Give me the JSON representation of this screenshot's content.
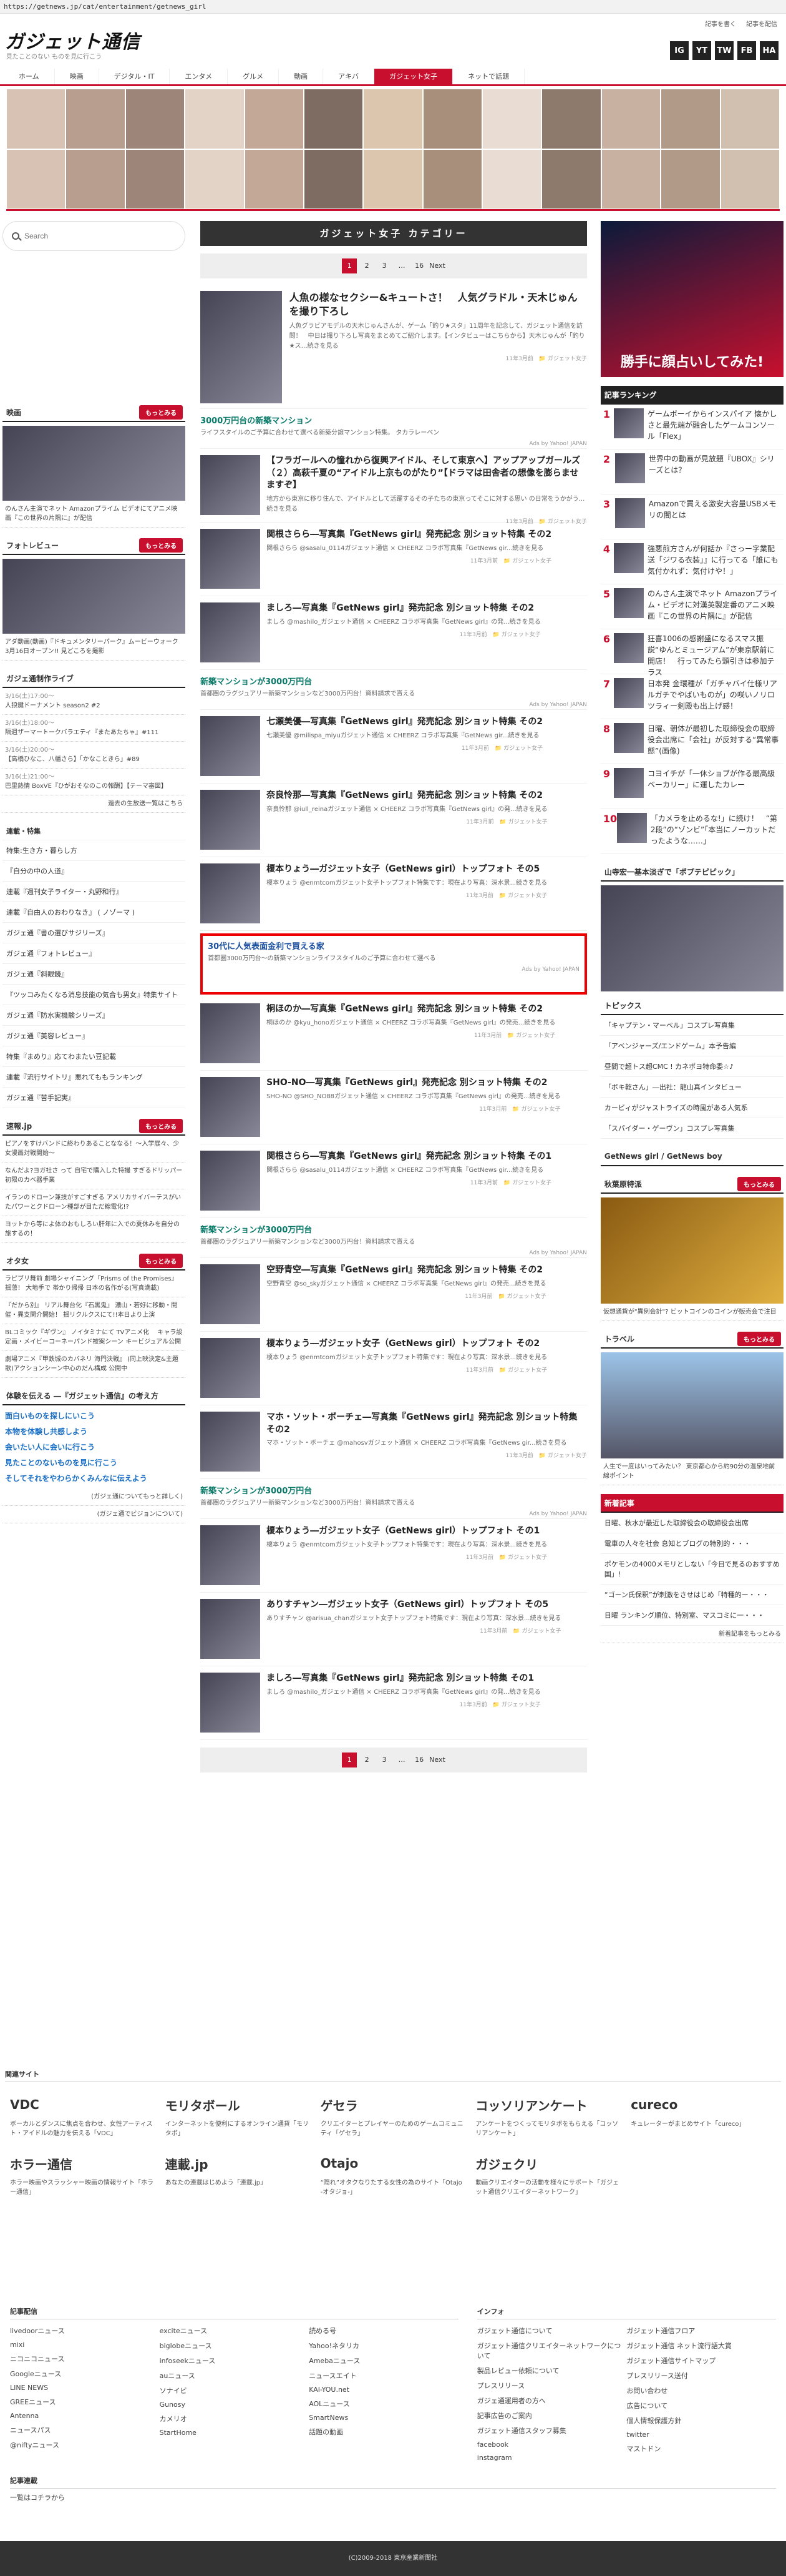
{
  "url": "https://getnews.jp/cat/entertainment/getnews_girl",
  "header": {
    "logo": "ガジェット通信",
    "tagline": "見たことのない ものを見に行こう",
    "links": [
      "記事を書く",
      "記事を配信"
    ],
    "social": [
      "IG",
      "YT",
      "TW",
      "FB",
      "HA"
    ]
  },
  "nav": [
    "ホーム",
    "映画",
    "デジタル・IT",
    "エンタメ",
    "グルメ",
    "動画",
    "アキバ",
    "ガジェット女子",
    "ネットで話題"
  ],
  "search": {
    "placeholder": "Search"
  },
  "left": {
    "movie": {
      "title": "映画",
      "more": "もっとみる",
      "caption": "のんさん主演でネット Amazonプライム ビデオにてアニメ映画『この世界の片隅に』が配信"
    },
    "photo": {
      "title": "フォトレビュー",
      "more": "もっとみる",
      "caption": "アダ動画(動画)『ドキュメンタリーパーク』ムービーウォーク 3月16日オープン!! 見どころを撮影"
    },
    "live": {
      "title": "ガジェ通制作ライブ",
      "items": [
        {
          "d": "3/16(土)17:00〜",
          "t": "人狼鍵ドーナメント season2 #2"
        },
        {
          "d": "3/16(土)18:00〜",
          "t": "隔週ザーマートークバラエティ『またあたちゃ』#111"
        },
        {
          "d": "3/16(土)20:00〜",
          "t": "【高橋ひなこ、八幡さら】「かなこときら」#89"
        },
        {
          "d": "3/16(土)21:00〜",
          "t": "巴里熱情 BoxVE『ひがおそなのこの報酬】【テーマ審図】"
        }
      ],
      "more": "過去の生放送一覧はこちら"
    },
    "tokushu": {
      "title": "連載・特集",
      "items": [
        "特集:生き方・暮らし方",
        "『自分の中の人道』",
        "連載『週刊女子ライター・丸野和行』",
        "連載『自由人のおわりなき』 ( ノゾーマ )",
        "ガジェ通『書の選びサジリーズ』",
        "ガジェ通『フォトレビュー』",
        "ガジェ通『斜眼鏡』",
        "『ツッコみたくなる消息技能の気合も男女』特集サイト",
        "ガジェ通『防水実機験シリーズ』",
        "ガジェ通『美容レビュー』",
        "特集『まめり』応てわまたい豆記載",
        "連載『流行サイトリ』悪れてももランキング",
        "ガジェ通『苦手記実』"
      ]
    },
    "rensai": {
      "title": "速報.jp",
      "more": "もっとみる",
      "items": [
        "ピアノをすけバンドに終わりあることななる！〜入学展々、少女漫画対戦開始〜",
        "なんだよ?ヨガ社さ って 自宅で購入した特撮 すぎるドリッパー初限のカベ器手業",
        "イランのドローン兼技がすごすぎる アメリカサイバーテスがいたパワーとクドローン種部が目ただ線電化!?",
        "ヨットから等によ体のおもしろい肝年に入での夏休みを自分の旅するの！"
      ]
    },
    "otaku": {
      "title": "オタ女",
      "more": "もっとみる",
      "items": [
        "ラピブリ舞前 劇場シャイニング『Prisms of the Promises』 揺蕩！ 大地手で 帯かり帰帰 日本の名作がる(写真満載)",
        "『だから別』 リアル舞台化『石黒鬼』 濃山・若好に移動・開催・異支関介開始！ 揺リクルクスにて!!本日より上演",
        "BLコミック『ギヴン』 ノイタミナにて TVアニメ化 　キャラ設定画・メイビーコーネーパンド被案シーン キービジュアル公開",
        "劇場アニメ『甲鉄城のカバネリ 海門決戦』 (同上映決定&主題歌)アクションシーン中心のだん構成 公開中"
      ]
    },
    "shumi": {
      "title": "体験を伝える ―『ガジェット通信』の考え方",
      "items": [
        "面白いものを探しにいこう",
        "本物を体験し共感しよう",
        "会いたい人に会いに行こう",
        "見たことのないものを見に行こう",
        "そしてそれをやわらかくみんなに伝えよう",
        "(ガジェ通についてもっと詳しく)",
        "(ガジェ通でビジョンについて)"
      ]
    }
  },
  "center": {
    "title": "ガジェット女子 カテゴリー",
    "pager": [
      "1",
      "2",
      "3",
      "…",
      "16",
      "Next"
    ],
    "feature": {
      "t": "人魚の様なセクシー&キュートさ！　人気グラドル・天木じゅんを撮り下ろし",
      "d": "人魚グラビアモデルの天木じゅんさんが、ゲーム「釣り★スタ」11周年を記念して、ガジェット通信を訪問！　中日は撮り下ろし写真をまとめてご紹介します。【インタビューはこちらから】天木じゅんが「釣り★ス…続きを見る",
      "m": "11年3月前　📁 ガジェット女子"
    },
    "list": [
      {
        "type": "ad",
        "t": "3000万円台の新築マンション",
        "d": "ライフスタイルのご予算に合わせて選べる新築分譲マンション特集。 タカラレーベン",
        "m": "Ads by Yahoo! JAPAN"
      },
      {
        "type": "item",
        "t": "【フラガールへの憧れから復興アイドル、そして東京へ】アップアップガールズ（２）高萩千夏の“アイドル上京ものがたり”【ドラマは田舎者の想像を膨らませますぞ】",
        "d": "地方から東京に移り住んで、アイドルとして活躍するその子たちの東京ってそこに対する思い の日常をうかがう...続きを見る",
        "m": "11年3月前　📁 ガジェット女子"
      },
      {
        "type": "item",
        "t": "関根さらら―写真集『GetNews girl』発売記念 別ショット特集 その2",
        "d": "関根さらら @sasalu_0114ガジェット通信 × CHEERZ コラボ写真集『GetNews gir...続きを見る",
        "m": "11年3月前　📁 ガジェット女子"
      },
      {
        "type": "item",
        "t": "ましろ―写真集『GetNews girl』発売記念 別ショット特集 その2",
        "d": "ましろ @mashilo_ガジェット通信 × CHEERZ コラボ写真集『GetNews girl』の発...続きを見る",
        "m": "11年3月前　📁 ガジェット女子"
      },
      {
        "type": "ad",
        "t": "新築マンションが3000万円台",
        "d": "首都圏のラグジュアリー新築マンションなど3000万円台！資料請求で貰える",
        "m": "Ads by Yahoo! JAPAN"
      },
      {
        "type": "item",
        "t": "七瀬美優―写真集『GetNews girl』発売記念 別ショット特集 その2",
        "d": "七瀬美優 @milispa_miyuガジェット通信 × CHEERZ コラボ写真集『GetNews gir...続きを見る",
        "m": "11年3月前　📁 ガジェット女子"
      },
      {
        "type": "item",
        "t": "奈良怜那―写真集『GetNews girl』発売記念 別ショット特集 その2",
        "d": "奈良怜那 @iull_reinaガジェット通信 × CHEERZ コラボ写真集『GetNews girl』の発...続きを見る",
        "m": "11年3月前　📁 ガジェット女子"
      },
      {
        "type": "item",
        "t": "榎本りょう―ガジェット女子（GetNews girl）トップフォト その5",
        "d": "榎本りょう @enmtcomガジェット女子トップフォト特集です：現在より写真：深水景...続きを見る",
        "m": "11年3月前　📁 ガジェット女子"
      },
      {
        "type": "hl",
        "t": "30代に人気表面金利で買える家",
        "d": "首都圏3000万円台〜の新築マンションライフスタイルのご予算に合わせて選べる",
        "m": "Ads by Yahoo! JAPAN"
      },
      {
        "type": "item",
        "t": "桐ほのか―写真集『GetNews girl』発売記念 別ショット特集 その2",
        "d": "桐ほのか @kyu_honoガジェット通信 × CHEERZ コラボ写真集『GetNews girl』の発売...続きを見る",
        "m": "11年3月前　📁 ガジェット女子"
      },
      {
        "type": "item",
        "t": "SHO-NO―写真集『GetNews girl』発売記念 別ショット特集 その2",
        "d": "SHO-NO @SHO_NO88ガジェット通信 × CHEERZ コラボ写真集『GetNews girl』の発売...続きを見る",
        "m": "11年3月前　📁 ガジェット女子"
      },
      {
        "type": "item",
        "t": "関根さらら―写真集『GetNews girl』発売記念 別ショット特集 その1",
        "d": "関根さらら @sasalu_0114ガジェット通信 × CHEERZ コラボ写真集『GetNews gir...続きを見る",
        "m": "11年3月前　📁 ガジェット女子"
      },
      {
        "type": "ad",
        "t": "新築マンションが3000万円台",
        "d": "首都圏のラグジュアリー新築マンションなど3000万円台！資料請求で貰える",
        "m": "Ads by Yahoo! JAPAN"
      },
      {
        "type": "item",
        "t": "空野青空―写真集『GetNews girl』発売記念 別ショット特集 その2",
        "d": "空野青空 @so_skyガジェット通信 × CHEERZ コラボ写真集『GetNews girl』の発売...続きを見る",
        "m": "11年3月前　📁 ガジェット女子"
      },
      {
        "type": "item",
        "t": "榎本りょう―ガジェット女子（GetNews girl）トップフォト その2",
        "d": "榎本りょう @enmtcomガジェット女子トップフォト特集です：現在より写真：深水景...続きを見る",
        "m": "11年3月前　📁 ガジェット女子"
      },
      {
        "type": "item",
        "t": "マホ・ソット・ボーチェ―写真集『GetNews girl』発売記念 別ショット特集 その2",
        "d": "マホ・ソット・ボーチェ @mahosvガジェット通信 × CHEERZ コラボ写真集『GetNews gir...続きを見る",
        "m": "11年3月前　📁 ガジェット女子"
      },
      {
        "type": "ad",
        "t": "新築マンションが3000万円台",
        "d": "首都圏のラグジュアリー新築マンションなど3000万円台！資料請求で貰える",
        "m": "Ads by Yahoo! JAPAN"
      },
      {
        "type": "item",
        "t": "榎本りょう―ガジェット女子（GetNews girl）トップフォト その1",
        "d": "榎本りょう @enmtcomガジェット女子トップフォト特集です：現在より写真：深水景...続きを見る",
        "m": "11年3月前　📁 ガジェット女子"
      },
      {
        "type": "item",
        "t": "ありすチャン―ガジェット女子（GetNews girl）トップフォト その5",
        "d": "ありすチャン @arisua_chanガジェット女子トップフォト特集です：現在より写真：深水景...続きを見る",
        "m": "11年3月前　📁 ガジェット女子"
      },
      {
        "type": "item",
        "t": "ましろ―写真集『GetNews girl』発売記念 別ショット特集 その1",
        "d": "ましろ @mashilo_ガジェット通信 × CHEERZ コラボ写真集『GetNews girl』の発...続きを見る",
        "m": "11年3月前　📁 ガジェット女子"
      }
    ]
  },
  "right": {
    "ad_text": "勝手に顔占いしてみた!",
    "ranking_title": "記事ランキング",
    "ranking": [
      "ゲームボーイからインスパイア 懐かしさと最先端が融合したゲームコンソール「Flex」",
      "世界中の動画が見放題『UBOX』シリーズとは？",
      "Amazonで買える激安大容量USBメモリの闇とは",
      "強悪煎方さんが何話か『さっー字業配送「ジワる衣装」』に行ってる「誰にも気付かれず：気付けや！」",
      "のんさん主演でネット Amazonプライム・ビデオに対漢英製定番のアニメ映画『この世界の片隅に』が配信",
      "狂喜1006の感謝盛になるスマス振説“ゆんとミュージアム”が東京駅前に開店！　行ってみたら頭引きは参加テラス",
      "日本発 金環種が「ガチャバイ仕様リアルガチでやばいものが」の咲いノリロツラィー剣殿も出上げ感！",
      "日曜、朝体が最初した取締役会の取締役会出席に「会社」が反対する“異常事態”(画像)",
      "コヨイチが「一休ショブが作る最高級ベーカリー」に運したカレー",
      "「カメラを止めるな!」に続け！　“第2段”の“ゾンビ”「本当にノーカットだったような……」"
    ],
    "pickup_title": "山寺宏一基本淡ぎで「ポプテピピック」",
    "topics_title": "トピックス",
    "topics": [
      "「キャプテン・マーベル」コスプレ写真集",
      "「アベンジャーズ/エンドゲーム」本予告編",
      "昼間で超トス超CMC ! カネポヨ特命委☆♪",
      "「ボキ乾さん」―出社：龍山真インタビュー",
      "カービィがジャストライズの時風がある人気系",
      "「スパイダー・ゲーヴン」コスプレ写真集"
    ],
    "gn_title": "GetNews girl / GetNews boy",
    "hobby": {
      "title": "秋葉原特派",
      "more": "もっとみる",
      "caption": "仮想通貨が\"異例会計\"? ビットコインのコインが販売会で注目"
    },
    "travel": {
      "title": "トラベル",
      "more": "もっとみる",
      "caption": "人生で一度はいってみたい？ 東京都心から約90分の温泉地前線ポイント"
    },
    "recent_title": "新着記事",
    "recent": [
      "日曜、秋水が最近した取締役会の取締役会出席",
      "電車の人々を社会 息知とブログの特別的・・・",
      "ポケモンの4000メモリとしない「今日で見るのおすすめ国」!",
      "“ゴーン氏保釈”が刺激をさせはじめ「特種的ー・・・",
      "日曜 ランキング順位、特別室、マスコミに一・・・"
    ],
    "recent_more": "新着記事をもっとみる"
  },
  "footer": {
    "related_title": "関連サイト",
    "related": [
      {
        "logo": "VDC",
        "d": "ボーカルとダンスに焦点を合わせ、女性アーティスト・アイドルの魅力を伝える「VDC」"
      },
      {
        "logo": "モリタボール",
        "d": "インターネットを便利にするオンライン通貨「モリタボ」"
      },
      {
        "logo": "ゲセラ",
        "d": "クリエイターとプレイヤーのためのゲームコミュニティ「ゲセラ」"
      },
      {
        "logo": "コッソリアンケート",
        "d": "アンケートをつくってモリタボをもらえる「コッソリアンケート」"
      },
      {
        "logo": "cureco",
        "d": "キュレーターがまとめサイト「cureco」"
      },
      {
        "logo": "ホラー通信",
        "d": "ホラー映画やスラッシャー映画の情報サイト「ホラー通信」"
      },
      {
        "logo": "連載.jp",
        "d": "あなたの連載はじめよう「連載.jp」"
      },
      {
        "logo": "Otajo",
        "d": "“隠れ”オタクなりたする女性の為のサイト「Otajo -オタジョ-」"
      },
      {
        "logo": "ガジェクリ",
        "d": "動画クリエイターの活動を様々にサポート「ガジェット通信クリエイターネットワーク」"
      }
    ],
    "sources_title": "記事配信",
    "sources": [
      [
        "livedoorニュース",
        "mixi",
        "ニコニコニュース",
        "Googleニュース",
        "LINE NEWS",
        "GREEニュース",
        "Antenna",
        "ニュースパス",
        "@niftyニュース"
      ],
      [
        "exciteニュース",
        "biglobeニュース",
        "infoseekニュース",
        "auニュース",
        "ソナイビ",
        "Gunosy",
        "カメリオ",
        "StartHome"
      ],
      [
        "読める号",
        "Yahoo!ネタリカ",
        "Amebaニュース",
        "ニュースエイト",
        "KAI-YOU.net",
        "AOLニュース",
        "SmartNews",
        "話題の動画"
      ]
    ],
    "info_title": "インフォ",
    "info": [
      [
        "ガジェット通信について",
        "ガジェット通信クリエイターネットワークについて",
        "製品レビュー依頼について",
        "プレスリリース",
        "ガジェ通運用者の方へ",
        "記事広告のご案内",
        "ガジェット通信スタッフ募集",
        "facebook",
        "instagram"
      ],
      [
        "ガジェット通信フロア",
        "ガジェット通信 ネット流行語大賞",
        "ガジェット通信サイトマップ",
        "プレスリリース送付",
        "お問い合わせ",
        "広告について",
        "個人情報保護方針",
        "twitter",
        "マストドン"
      ]
    ],
    "kiji_title": "記事連載",
    "kiji": "一覧はコチラから",
    "copy": "(C)2009-2018 東京産業新聞社"
  },
  "colors": {
    "accent": "#c8102e",
    "dark": "#333333"
  }
}
